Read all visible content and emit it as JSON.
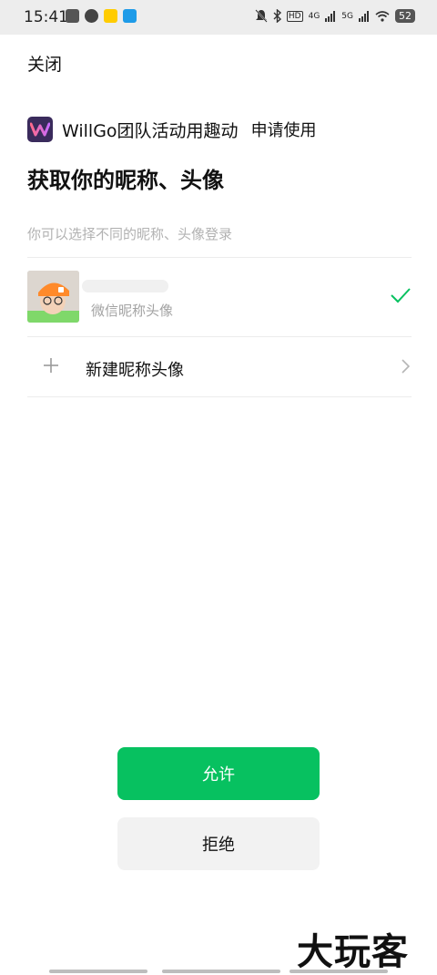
{
  "status_bar": {
    "time": "15:41",
    "hd_label": "HD",
    "net_4g": "4G",
    "net_5g": "5G",
    "battery": "52",
    "left_icons": [
      "cloud-icon",
      "play-icon",
      "meituan-icon",
      "e-icon"
    ],
    "right_icons": [
      "mute-bell-icon",
      "bluetooth-icon",
      "signal-icon",
      "wifi-icon",
      "battery-icon"
    ]
  },
  "header": {
    "close_label": "关闭"
  },
  "app": {
    "name": "WillGo团队活动用趣动",
    "request_label": "申请使用",
    "logo_color": "#3a2b5c"
  },
  "main": {
    "title": "获取你的昵称、头像",
    "subtitle": "你可以选择不同的昵称、头像登录"
  },
  "profile": {
    "label": "微信昵称头像",
    "selected": true
  },
  "new_profile": {
    "label": "新建昵称头像"
  },
  "actions": {
    "allow_label": "允许",
    "reject_label": "拒绝",
    "allow_color": "#07c160",
    "reject_color": "#f2f2f2"
  },
  "watermark": {
    "text": "大玩客"
  }
}
